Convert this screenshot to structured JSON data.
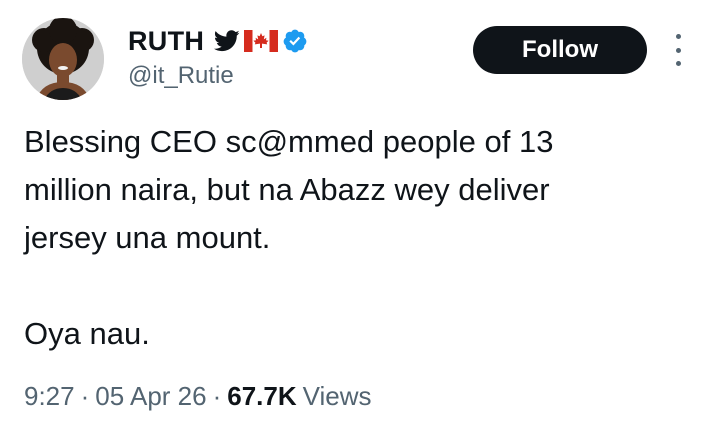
{
  "author": {
    "display_name": "RUTH",
    "handle": "@it_Rutie",
    "name_icons": [
      "twitter-bird-icon",
      "canada-flag-icon",
      "verified-badge-icon"
    ],
    "verified_color": "#1d9bf0"
  },
  "actions": {
    "follow_label": "Follow",
    "more_icon": "more-options-icon"
  },
  "tweet": {
    "lines": [
      "Blessing CEO sc@mmed people of 13",
      "million naira, but na Abazz wey deliver",
      "jersey una mount.",
      "Oya nau."
    ]
  },
  "meta": {
    "time": "9:27",
    "date": "05 Apr 26",
    "separator": "·",
    "views_count": "67.7K",
    "views_label": "Views"
  },
  "colors": {
    "text": "#0f1419",
    "secondary": "#536471",
    "follow_bg": "#0f1419",
    "flag_red": "#d52b1e"
  }
}
